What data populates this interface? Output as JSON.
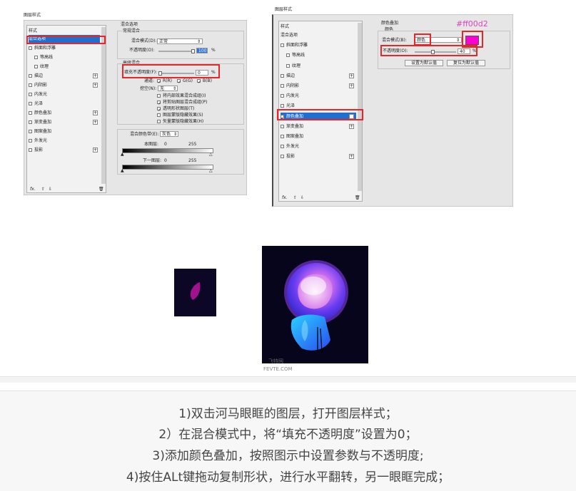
{
  "left_dialog": {
    "title": "图层样式",
    "list_header": "样式",
    "items": [
      {
        "label": "混合选项",
        "selected": true,
        "plus": false,
        "check": false
      },
      {
        "label": "斜面和浮雕",
        "check": true,
        "plus": false
      },
      {
        "label": "等高线",
        "check": true,
        "plus": false,
        "indent": true
      },
      {
        "label": "纹理",
        "check": true,
        "plus": false,
        "indent": true
      },
      {
        "label": "描边",
        "check": true,
        "plus": true
      },
      {
        "label": "内阴影",
        "check": true,
        "plus": true
      },
      {
        "label": "内发光",
        "check": true,
        "plus": false
      },
      {
        "label": "光泽",
        "check": true,
        "plus": false
      },
      {
        "label": "颜色叠加",
        "check": true,
        "plus": true
      },
      {
        "label": "渐变叠加",
        "check": true,
        "plus": true
      },
      {
        "label": "图案叠加",
        "check": true,
        "plus": false
      },
      {
        "label": "外发光",
        "check": true,
        "plus": false
      },
      {
        "label": "投影",
        "check": true,
        "plus": true
      }
    ],
    "footer_fx": "fx.",
    "blend_options_title": "混合选项",
    "general_blend_title": "常规混合",
    "blend_mode_label": "混合模式(D):",
    "blend_mode_value": "正常",
    "opacity_label": "不透明度(O):",
    "opacity_value": "100",
    "percent": "%",
    "advanced_blend_title": "高级混合",
    "fill_opacity_label": "填充不透明度(F):",
    "fill_opacity_value": "0",
    "channels_label": "通道:",
    "channels": [
      "R(R)",
      "G(G)",
      "B(B)"
    ],
    "knockout_label": "挖空(N):",
    "knockout_value": "无",
    "options": [
      {
        "label": "将内部效果混合成组(I)",
        "checked": false
      },
      {
        "label": "将剪贴图层混合成组(P)",
        "checked": true
      },
      {
        "label": "透明形状图层(T)",
        "checked": true
      },
      {
        "label": "图层蒙版隐藏效果(S)",
        "checked": false
      },
      {
        "label": "矢量蒙版隐藏效果(H)",
        "checked": false
      }
    ],
    "blend_if_label": "混合颜色带(E):",
    "blend_if_value": "灰色",
    "this_layer_label": "本图层:",
    "this_layer_min": "0",
    "this_layer_max": "255",
    "below_layer_label": "下一图层:",
    "below_layer_min": "0",
    "below_layer_max": "255"
  },
  "right_dialog": {
    "title": "图层样式",
    "list_header": "样式",
    "items": [
      {
        "label": "混合选项",
        "check": false,
        "plus": false
      },
      {
        "label": "斜面和浮雕",
        "check": true,
        "plus": false
      },
      {
        "label": "等高线",
        "check": true,
        "plus": false,
        "indent": true
      },
      {
        "label": "纹理",
        "check": true,
        "plus": false,
        "indent": true
      },
      {
        "label": "描边",
        "check": true,
        "plus": true
      },
      {
        "label": "内阴影",
        "check": true,
        "plus": true
      },
      {
        "label": "内发光",
        "check": true,
        "plus": false
      },
      {
        "label": "光泽",
        "check": true,
        "plus": false
      },
      {
        "label": "颜色叠加",
        "check": true,
        "plus": true,
        "selected": true
      },
      {
        "label": "渐变叠加",
        "check": true,
        "plus": true
      },
      {
        "label": "图案叠加",
        "check": true,
        "plus": false
      },
      {
        "label": "外发光",
        "check": true,
        "plus": false
      },
      {
        "label": "投影",
        "check": true,
        "plus": true
      }
    ],
    "footer_fx": "fx.",
    "section_title": "颜色叠加",
    "sub_title": "颜色",
    "blend_mode_label": "混合模式(B):",
    "blend_mode_value": "颜色",
    "opacity_label": "不透明度(O):",
    "opacity_value": "40",
    "percent": "%",
    "color_annotation": "#ff00d2",
    "swatch_color": "#ff00d2",
    "btn_default": "设置为默认值",
    "btn_reset": "复位为默认值"
  },
  "watermark": {
    "line1": "飞特网",
    "line2": "FEVTE.COM"
  },
  "steps": [
    "1)双击河马眼眶的图层，打开图层样式；",
    "2）在混合模式中，将“填充不透明度”设置为0；",
    "3)添加颜色叠加，按照图示中设置参数与不透明度;",
    "4)按住ALt键拖动复制形状，进行水平翻转，另一眼眶完成；"
  ]
}
